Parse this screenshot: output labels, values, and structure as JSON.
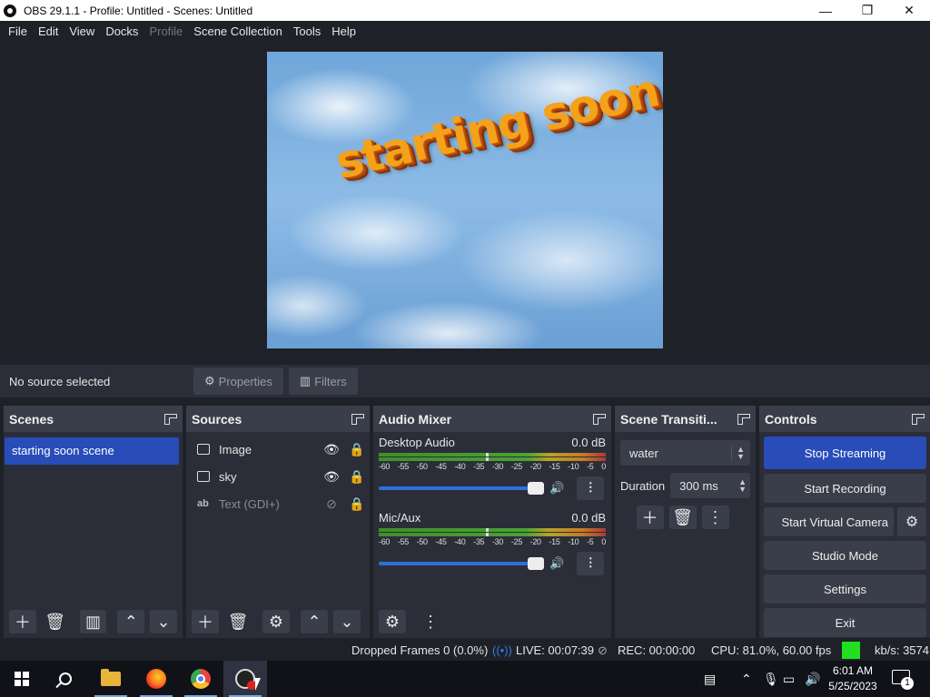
{
  "window": {
    "title": "OBS 29.1.1 - Profile: Untitled - Scenes: Untitled",
    "minimize": "—",
    "maximize": "❐",
    "close": "✕"
  },
  "menu": [
    "File",
    "Edit",
    "View",
    "Docks",
    "Profile",
    "Scene Collection",
    "Tools",
    "Help"
  ],
  "preview": {
    "overlay_text": "starting soon"
  },
  "source_toolbar": {
    "status": "No source selected",
    "properties_label": "Properties",
    "filters_label": "Filters"
  },
  "scenes": {
    "title": "Scenes",
    "items": [
      "starting soon scene"
    ]
  },
  "sources": {
    "title": "Sources",
    "items": [
      {
        "name": "Image",
        "type_icon": "image-icon",
        "visible": true,
        "locked": false
      },
      {
        "name": "sky",
        "type_icon": "image-icon",
        "visible": true,
        "locked": false
      },
      {
        "name": "Text (GDI+)",
        "type_icon": "text-icon",
        "type_label": "ab",
        "visible": false,
        "locked": false
      }
    ]
  },
  "mixer": {
    "title": "Audio Mixer",
    "channels": [
      {
        "name": "Desktop Audio",
        "db": "0.0 dB",
        "volume_fraction": 1.0
      },
      {
        "name": "Mic/Aux",
        "db": "0.0 dB",
        "volume_fraction": 1.0
      }
    ],
    "scale": [
      "-60",
      "-55",
      "-50",
      "-45",
      "-40",
      "-35",
      "-30",
      "-25",
      "-20",
      "-15",
      "-10",
      "-5",
      "0"
    ]
  },
  "transitions": {
    "title": "Scene Transiti...",
    "selected": "water",
    "duration_label": "Duration",
    "duration_value": "300 ms"
  },
  "controls": {
    "title": "Controls",
    "stop_streaming": "Stop Streaming",
    "start_recording": "Start Recording",
    "start_virtual_camera": "Start Virtual Camera",
    "studio_mode": "Studio Mode",
    "settings": "Settings",
    "exit": "Exit"
  },
  "status": {
    "dropped_frames": "Dropped Frames 0 (0.0%)",
    "live": "LIVE: 00:07:39",
    "rec": "REC: 00:00:00",
    "cpu": "CPU: 81.0%, 60.00 fps",
    "bitrate": "kb/s: 3574",
    "indicator_color": "#20e020"
  },
  "taskbar": {
    "apps": [
      "start-icon",
      "search-icon",
      "file-explorer-icon",
      "firefox-icon",
      "chrome-icon",
      "obs-icon"
    ],
    "time": "6:01 AM",
    "date": "5/25/2023",
    "notification_count": "1"
  },
  "colors": {
    "accent_blue": "#284cb8",
    "panel_bg": "#2b2e38",
    "window_bg": "#1f2128"
  }
}
